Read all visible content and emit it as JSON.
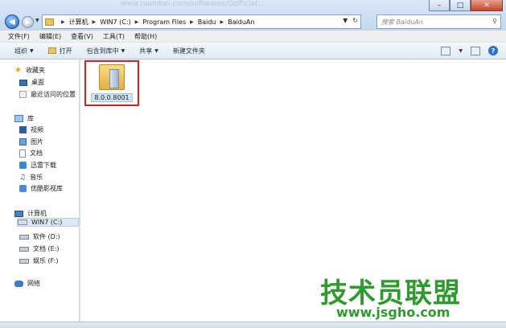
{
  "window": {
    "watermark_text": "www.ruanmei.com/softwares/Gofficial...",
    "minimize_glyph": "–",
    "maximize_glyph": "□",
    "close_glyph": "✕"
  },
  "address": {
    "crumbs": [
      "计算机",
      "WIN7 (C:)",
      "Program Files",
      "Baidu",
      "BaiduAn"
    ],
    "refresh_glyph": "↻"
  },
  "search": {
    "placeholder": "搜索 BaiduAn"
  },
  "menu": [
    "文件(F)",
    "编辑(E)",
    "查看(V)",
    "工具(T)",
    "帮助(H)"
  ],
  "toolbar": {
    "organize": "组织",
    "open": "打开",
    "include_library": "包含到库中",
    "share": "共享",
    "new_folder": "新建文件夹"
  },
  "navpane": {
    "favorites": "收藏夹",
    "desktop": "桌面",
    "recent": "最近访问的位置",
    "libraries": "库",
    "video": "视频",
    "pictures": "图片",
    "documents": "文档",
    "thunder": "迅雷下载",
    "music": "音乐",
    "youku": "优酷影视库",
    "computer": "计算机",
    "drive_c": "WIN7 (C:)",
    "drive_d": "软件 (D:)",
    "drive_e": "文档 (E:)",
    "drive_f": "娱乐 (F:)",
    "network": "网络"
  },
  "content": {
    "folder_name": "8.0.0.8001"
  },
  "watermark": {
    "text": "技术员联盟",
    "url": "www.jsgho.com"
  }
}
